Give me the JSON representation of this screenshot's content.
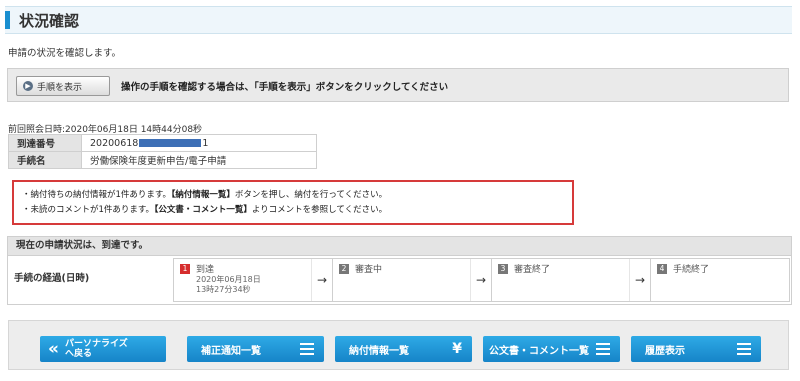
{
  "page": {
    "title": "状況確認"
  },
  "intro": "申請の状況を確認します。",
  "procedure": {
    "button_label": "手順を表示",
    "text": "操作の手順を確認する場合は、「手順を表示」ボタンをクリックしてください"
  },
  "last_reference": "前回照会日時:2020年06月18日 14時44分08秒",
  "info": {
    "arrival_label": "到達番号",
    "arrival_prefix": "20200618",
    "arrival_suffix": "1",
    "procedure_label": "手続名",
    "procedure_value": "労働保険年度更新申告/電子申請"
  },
  "notice": {
    "line1_pre": "・納付待ちの納付情報が1件あります。",
    "line1_bold": "【納付情報一覧】",
    "line1_post": "ボタンを押し、納付を行ってください。",
    "line2_pre": "・未読のコメントが1件あります。",
    "line2_bold": "【公文書・コメント一覧】",
    "line2_post": "よりコメントを参照してください。"
  },
  "status": {
    "heading": "現在の申請状況は、到達です。",
    "row_label": "手続の経過(日時)",
    "steps": [
      {
        "num": "1",
        "name": "到達",
        "date1": "2020年06月18日",
        "date2": "13時27分34秒"
      },
      {
        "num": "2",
        "name": "審査中"
      },
      {
        "num": "3",
        "name": "審査終了"
      },
      {
        "num": "4",
        "name": "手続終了"
      }
    ],
    "arrow": "→"
  },
  "footer": {
    "back_line1": "パーソナライズ",
    "back_line2": "へ戻る",
    "back_icon": "«",
    "correction": "補正通知一覧",
    "payment": "納付情報一覧",
    "payment_icon": "¥",
    "documents": "公文書・コメント一覧",
    "history": "履歴表示"
  },
  "colors": {
    "accent": "#1a8fd0",
    "notice_border": "#d63a3a",
    "button": "#1e96d6",
    "active_step": "#d62d2d"
  }
}
